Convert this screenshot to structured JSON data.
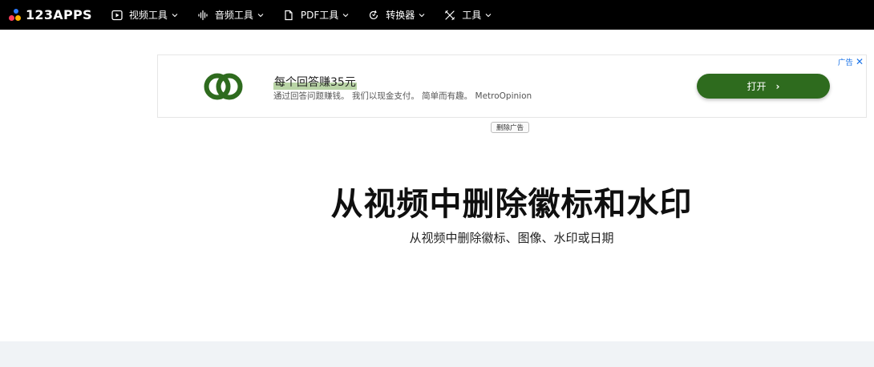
{
  "brand": {
    "name": "123APPS"
  },
  "nav": [
    {
      "label": "视频工具",
      "icon": "play-square-icon"
    },
    {
      "label": "音频工具",
      "icon": "waveform-icon"
    },
    {
      "label": "PDF工具",
      "icon": "document-icon"
    },
    {
      "label": "转换器",
      "icon": "convert-icon"
    },
    {
      "label": "工具",
      "icon": "tools-icon"
    }
  ],
  "ad": {
    "title": "每个回答赚35元",
    "subtitle": "通过回答问题赚钱。 我们以现金支付。 简单而有趣。 MetroOpinion",
    "button_label": "打开",
    "choices_label": "广告",
    "logo_color": "#2e6b1e"
  },
  "remove_ad_label": "删除广告",
  "page": {
    "title": "从视频中删除徽标和水印",
    "subtitle": "从视频中删除徽标、图像、水印或日期"
  },
  "colors": {
    "topbar": "#000000",
    "ad_button": "#2e6b1e",
    "footer_band": "#f0f3f6"
  }
}
